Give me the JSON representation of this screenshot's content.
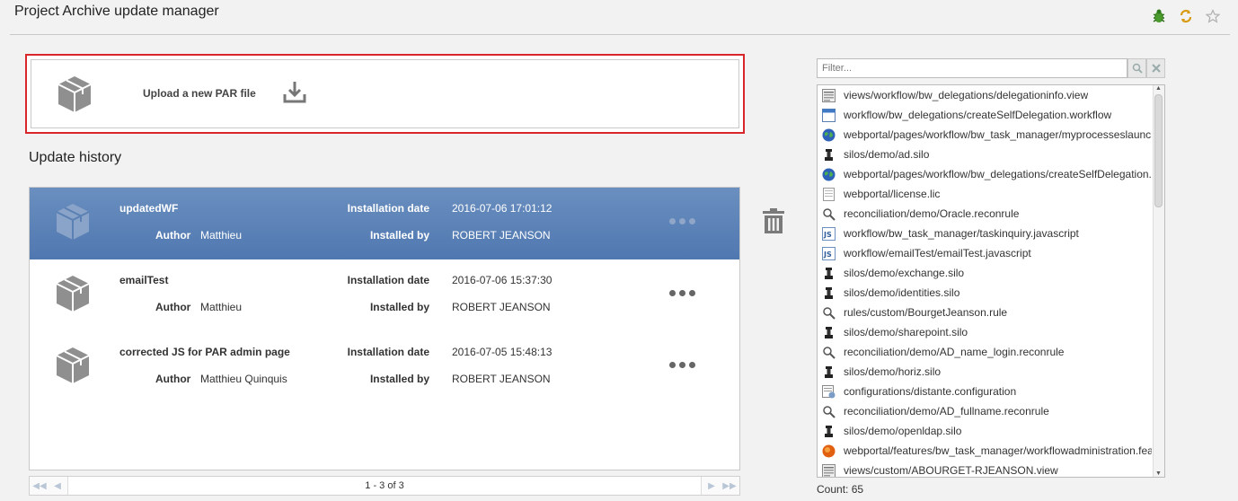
{
  "page": {
    "title": "Project Archive update manager"
  },
  "header_icons": [
    "bug-icon",
    "refresh-icon",
    "star-icon"
  ],
  "upload": {
    "label": "Upload a new PAR file"
  },
  "history": {
    "title": "Update history",
    "labels": {
      "installation_date": "Installation date",
      "author": "Author",
      "installed_by": "Installed by"
    },
    "rows": [
      {
        "name": "updatedWF",
        "author": "Matthieu",
        "installation_date": "2016-07-06 17:01:12",
        "installed_by": "ROBERT JEANSON",
        "selected": true
      },
      {
        "name": "emailTest",
        "author": "Matthieu",
        "installation_date": "2016-07-06 15:37:30",
        "installed_by": "ROBERT JEANSON",
        "selected": false
      },
      {
        "name": "corrected JS for PAR admin page",
        "author": "Matthieu Quinquis",
        "installation_date": "2016-07-05 15:48:13",
        "installed_by": "ROBERT JEANSON",
        "selected": false
      }
    ]
  },
  "pager": {
    "text": "1 - 3 of 3"
  },
  "filter": {
    "placeholder": "Filter..."
  },
  "files": [
    {
      "icon": "view-icon",
      "path": "views/workflow/bw_delegations/delegationinfo.view"
    },
    {
      "icon": "workflow-icon",
      "path": "workflow/bw_delegations/createSelfDelegation.workflow"
    },
    {
      "icon": "globe-icon",
      "path": "webportal/pages/workflow/bw_task_manager/myprocesseslaunch"
    },
    {
      "icon": "silo-icon",
      "path": "silos/demo/ad.silo"
    },
    {
      "icon": "globe-icon",
      "path": "webportal/pages/workflow/bw_delegations/createSelfDelegation.p"
    },
    {
      "icon": "license-icon",
      "path": "webportal/license.lic"
    },
    {
      "icon": "magnifier-icon",
      "path": "reconciliation/demo/Oracle.reconrule"
    },
    {
      "icon": "javascript-icon",
      "path": "workflow/bw_task_manager/taskinquiry.javascript"
    },
    {
      "icon": "javascript-icon",
      "path": "workflow/emailTest/emailTest.javascript"
    },
    {
      "icon": "silo-icon",
      "path": "silos/demo/exchange.silo"
    },
    {
      "icon": "silo-icon",
      "path": "silos/demo/identities.silo"
    },
    {
      "icon": "magnifier-icon",
      "path": "rules/custom/BourgetJeanson.rule"
    },
    {
      "icon": "silo-icon",
      "path": "silos/demo/sharepoint.silo"
    },
    {
      "icon": "magnifier-icon",
      "path": "reconciliation/demo/AD_name_login.reconrule"
    },
    {
      "icon": "silo-icon",
      "path": "silos/demo/horiz.silo"
    },
    {
      "icon": "configuration-icon",
      "path": "configurations/distante.configuration"
    },
    {
      "icon": "magnifier-icon",
      "path": "reconciliation/demo/AD_fullname.reconrule"
    },
    {
      "icon": "silo-icon",
      "path": "silos/demo/openldap.silo"
    },
    {
      "icon": "feature-icon",
      "path": "webportal/features/bw_task_manager/workflowadministration.fea"
    },
    {
      "icon": "view-icon",
      "path": "views/custom/ABOURGET-RJEANSON.view"
    }
  ],
  "count": {
    "text": "Count: 65"
  }
}
